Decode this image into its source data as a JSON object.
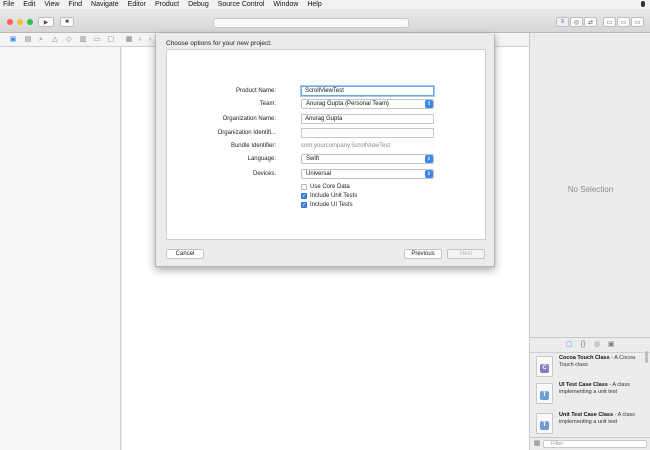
{
  "menubar": {
    "items": [
      "File",
      "Edit",
      "View",
      "Find",
      "Navigate",
      "Editor",
      "Product",
      "Debug",
      "Source Control",
      "Window",
      "Help"
    ]
  },
  "dialog": {
    "title": "Choose options for your new project:",
    "fields": {
      "product_name_label": "Product Name:",
      "product_name_value": "ScrollViewTest",
      "team_label": "Team:",
      "team_value": "Anurag Gupta (Personal Team)",
      "org_name_label": "Organization Name:",
      "org_name_value": "Anurag Gupta",
      "org_identifier_label": "Organization Identifi...",
      "org_identifier_value": "",
      "bundle_identifier_label": "Bundle Identifier:",
      "bundle_identifier_value": "com.yourcompany.ScrollViewTest",
      "language_label": "Language:",
      "language_value": "Swift",
      "devices_label": "Devices:",
      "devices_value": "Universal"
    },
    "checkboxes": [
      {
        "label": "Use Core Data",
        "checked": false
      },
      {
        "label": "Include Unit Tests",
        "checked": true
      },
      {
        "label": "Include UI Tests",
        "checked": true
      }
    ],
    "buttons": {
      "cancel": "Cancel",
      "previous": "Previous",
      "next": "Next"
    }
  },
  "inspector": {
    "no_selection": "No Selection",
    "library": [
      {
        "title": "Cocoa Touch Class",
        "desc": " - A Cocoa Touch class",
        "icon": "C",
        "color": "#8e7cc3"
      },
      {
        "title": "UI Test Case Class",
        "desc": " - A class implementing a unit test",
        "icon": "T",
        "color": "#6f9bd8"
      },
      {
        "title": "Unit Test Case Class",
        "desc": " - A class implementing a unit test",
        "icon": "T",
        "color": "#6f9bd8"
      }
    ],
    "filter_placeholder": "Filter"
  },
  "colors": {
    "accent": "#3b86e8",
    "focus_ring": "#6aa7ea"
  }
}
